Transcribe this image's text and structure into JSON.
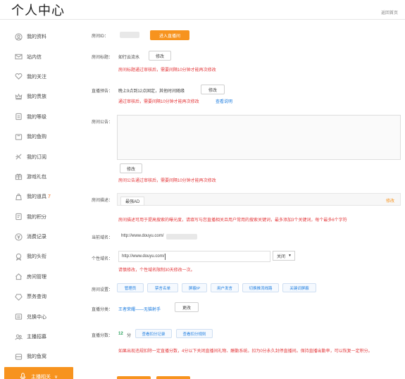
{
  "header": {
    "title": "个人中心",
    "back_link": "返回首页"
  },
  "sidebar": {
    "items": [
      {
        "label": "我的资料",
        "icon": "user-circle-icon"
      },
      {
        "label": "站内信",
        "icon": "mail-icon"
      },
      {
        "label": "我的关注",
        "icon": "heart-icon"
      },
      {
        "label": "我的贵族",
        "icon": "crown-icon"
      },
      {
        "label": "我的等级",
        "icon": "level-icon"
      },
      {
        "label": "我的鱼购",
        "icon": "cart-icon"
      },
      {
        "label": "我的订阅",
        "icon": "subscribe-icon"
      },
      {
        "label": "游戏礼包",
        "icon": "gift-icon"
      },
      {
        "label": "我的道具",
        "icon": "item-icon",
        "badge": "7"
      },
      {
        "label": "我的积分",
        "icon": "points-icon"
      },
      {
        "label": "消费记录",
        "icon": "yen-icon"
      },
      {
        "label": "我的头衔",
        "icon": "medal-icon"
      },
      {
        "label": "房间管理",
        "icon": "home-icon"
      },
      {
        "label": "票务查询",
        "icon": "ticket-icon"
      },
      {
        "label": "兑换中心",
        "icon": "exchange-icon"
      },
      {
        "label": "主播招募",
        "icon": "recruit-icon"
      },
      {
        "label": "我的鱼窝",
        "icon": "nest-icon"
      },
      {
        "label": "主播相关",
        "icon": "mic-icon",
        "active": true,
        "chevron": "∨"
      }
    ]
  },
  "room": {
    "id_label": "房间ID：",
    "enter_button": "进入直播间",
    "title_label": "房间标题：",
    "title_value": "如行云流水",
    "title_edit": "修改",
    "title_note": "房间标题通过审核后，需要间隔10分钟才能再次修改",
    "preview_label": "直播预告：",
    "preview_value": "晚上9点到12点固定，其他时间随缘",
    "preview_edit": "修改",
    "preview_note": "通过审核后，需要间隔10分钟才能再次修改",
    "preview_note_link": "查看说明",
    "notice_label": "房间公告：",
    "notice_edit": "修改",
    "notice_note": "房间公告通过审核后，需要间隔10分钟才能再次修改",
    "desc_label": "房间描述：",
    "desc_tag": "最强AD",
    "desc_edit": "修改",
    "desc_note": "房间描述可用于提高搜索的曝光度，请填写与您直播相关且用户常用的搜索关键词，最多添加3个关键词，每个最多6个字符",
    "domain_label": "当前域名：",
    "domain_value": "http://www.douyu.com/",
    "custom_domain_label": "个性域名：",
    "custom_domain_prefix": "http://www.douyu.com/",
    "custom_domain_select": "关闭",
    "custom_domain_note": "请慎修改，个性域名限制30天修改一次。",
    "settings_label": "房间设置：",
    "settings_buttons": [
      "管理员",
      "禁言名单",
      "屏蔽IP",
      "用户发言",
      "切换推流线路",
      "关键词屏蔽"
    ],
    "category_label": "直播分类：",
    "category_value": "王者荣耀——无猫射手",
    "category_edit": "更改",
    "score_label": "直播分数：",
    "score_value": "12",
    "score_unit": "分",
    "score_buttons": [
      "查看扣分记录",
      "查看扣分规则"
    ],
    "score_note": "如果出现违规扣除一定直播分数，4分以下关闭直播间礼物、酬勤系统。扣为0分永久封停直播间。保持直播出勤率，可以恢复一定积分。"
  },
  "colors": {
    "accent": "#f7931e",
    "warning": "#e4393c",
    "link": "#1f7ee0",
    "score": "#27a05a"
  }
}
